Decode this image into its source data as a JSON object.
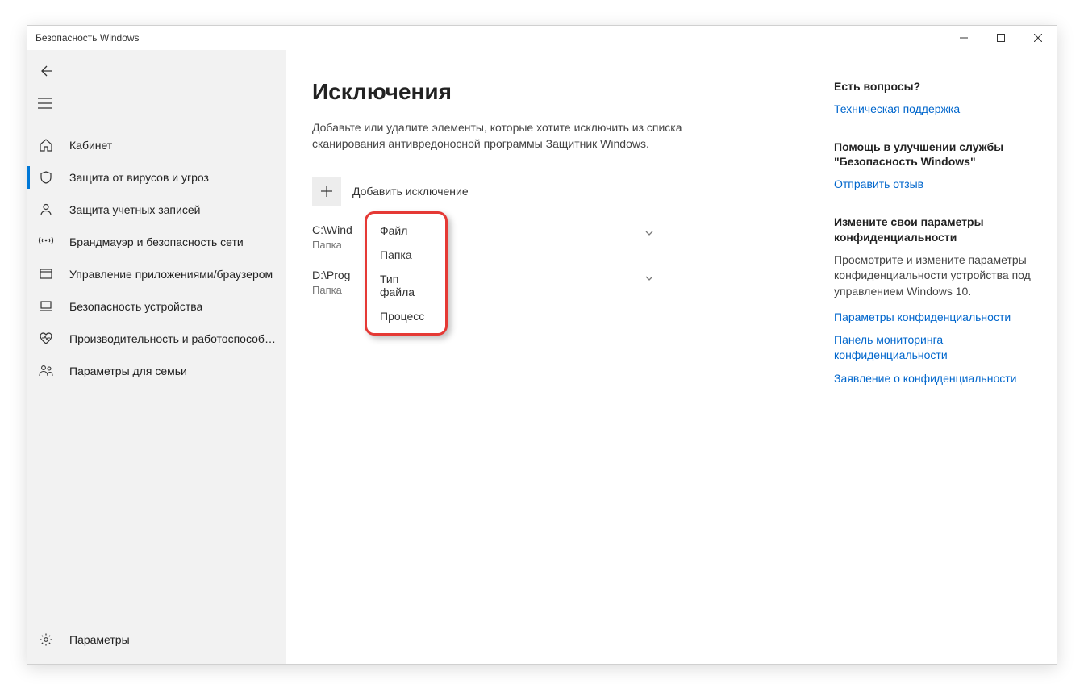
{
  "window": {
    "title": "Безопасность Windows"
  },
  "sidebar": {
    "items": [
      {
        "label": "Кабинет"
      },
      {
        "label": "Защита от вирусов и угроз"
      },
      {
        "label": "Защита учетных записей"
      },
      {
        "label": "Брандмауэр и безопасность сети"
      },
      {
        "label": "Управление приложениями/браузером"
      },
      {
        "label": "Безопасность устройства"
      },
      {
        "label": "Производительность и работоспособность устройства"
      },
      {
        "label": "Параметры для семьи"
      }
    ],
    "settings_label": "Параметры"
  },
  "page": {
    "title": "Исключения",
    "description": "Добавьте или удалите элементы, которые хотите исключить из списка сканирования антивредоносной программы Защитник Windows.",
    "add_label": "Добавить исключение",
    "exclusions": [
      {
        "path": "C:\\Wind",
        "type": "Папка"
      },
      {
        "path": "D:\\Prog",
        "type": "Папка"
      }
    ]
  },
  "dropdown": {
    "items": [
      "Файл",
      "Папка",
      "Тип файла",
      "Процесс"
    ]
  },
  "right": {
    "sections": [
      {
        "heading": "Есть вопросы?",
        "links": [
          "Техническая поддержка"
        ]
      },
      {
        "heading": "Помощь в улучшении службы \"Безопасность Windows\"",
        "links": [
          "Отправить отзыв"
        ]
      },
      {
        "heading": "Измените свои параметры конфиденциальности",
        "text": "Просмотрите и измените параметры конфиденциальности устройства под управлением Windows 10.",
        "links": [
          "Параметры конфиденциальности",
          "Панель мониторинга конфиденциальности",
          "Заявление о конфиденциальности"
        ]
      }
    ]
  }
}
